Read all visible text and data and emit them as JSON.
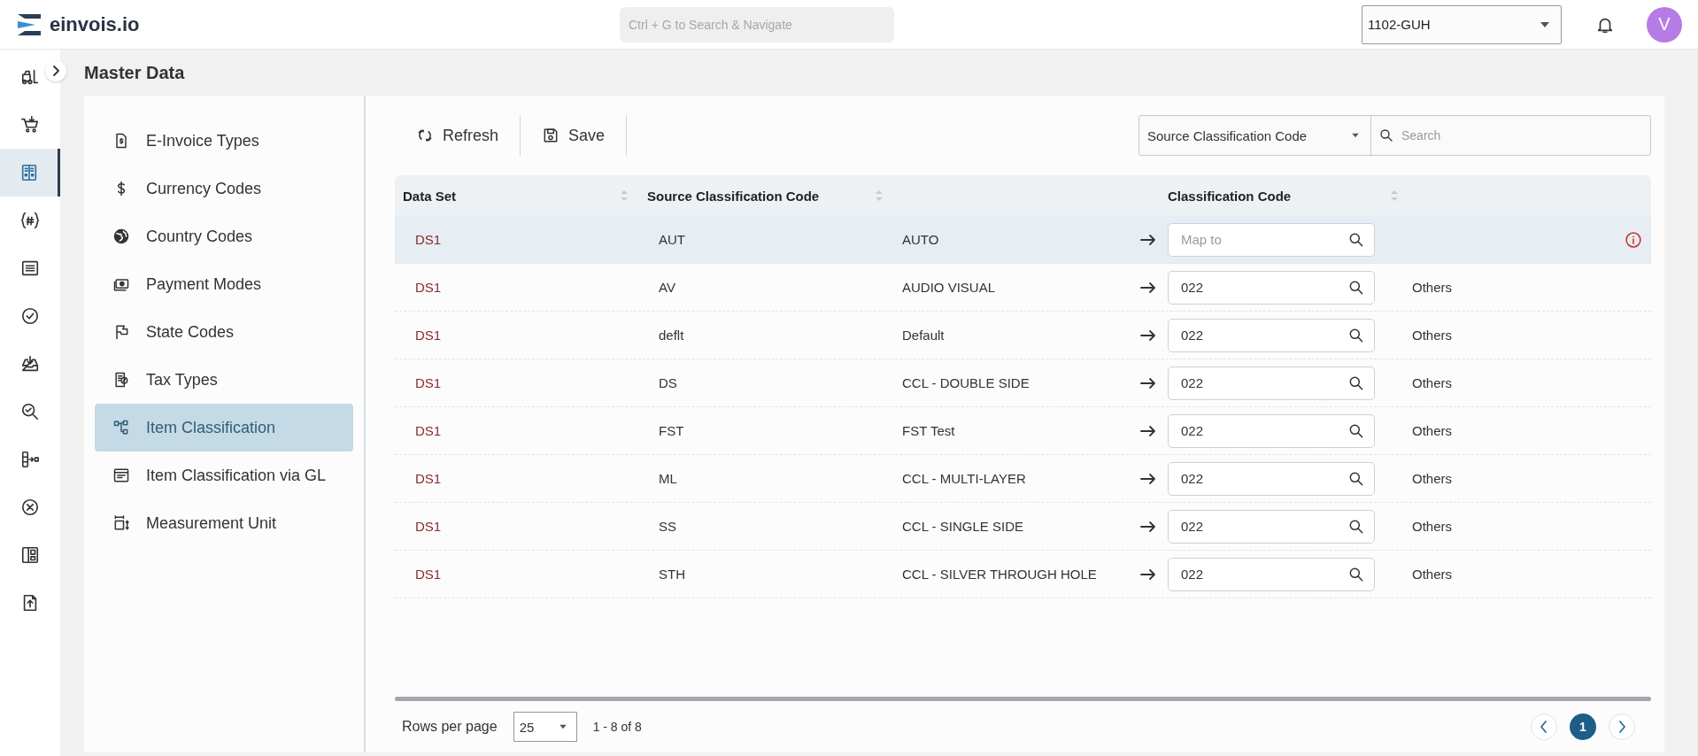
{
  "brand": {
    "name": "einvois.io"
  },
  "global_search": {
    "placeholder": "Ctrl + G to Search & Navigate"
  },
  "company_select": {
    "value": "1102-GUH"
  },
  "avatar": {
    "initial": "V"
  },
  "rail": [
    {
      "selected": false
    },
    {
      "selected": false
    },
    {
      "selected": true
    },
    {
      "selected": false
    },
    {
      "selected": false
    },
    {
      "selected": false
    },
    {
      "selected": false
    },
    {
      "selected": false
    },
    {
      "selected": false
    },
    {
      "selected": false
    },
    {
      "selected": false
    },
    {
      "selected": false
    }
  ],
  "page_title": "Master Data",
  "menu": [
    {
      "label": "E-Invoice Types",
      "selected": false
    },
    {
      "label": "Currency Codes",
      "selected": false
    },
    {
      "label": "Country Codes",
      "selected": false
    },
    {
      "label": "Payment Modes",
      "selected": false
    },
    {
      "label": "State Codes",
      "selected": false
    },
    {
      "label": "Tax Types",
      "selected": false
    },
    {
      "label": "Item Classification",
      "selected": true
    },
    {
      "label": "Item Classification via GL",
      "selected": false
    },
    {
      "label": "Measurement Unit",
      "selected": false
    }
  ],
  "toolbar": {
    "buttons": [
      {
        "label": "Refresh",
        "kind": "refresh"
      },
      {
        "label": "Save",
        "kind": "save"
      }
    ],
    "filter_select": {
      "value": "Source Classification Code"
    },
    "search": {
      "placeholder": "Search"
    }
  },
  "table": {
    "columns": [
      {
        "label": "Data Set"
      },
      {
        "label": "Source Classification Code"
      },
      {
        "label": "Classification Code"
      }
    ],
    "rows": [
      {
        "data_set": "DS1",
        "source_code": "AUT",
        "description": "AUTO",
        "code_placeholder": "Map to",
        "selected": true,
        "error": true
      },
      {
        "data_set": "DS1",
        "source_code": "AV",
        "description": "AUDIO VISUAL",
        "code": "022",
        "code_name": "Others",
        "selected": false,
        "error": false
      },
      {
        "data_set": "DS1",
        "source_code": "deflt",
        "description": "Default",
        "code": "022",
        "code_name": "Others",
        "selected": false,
        "error": false
      },
      {
        "data_set": "DS1",
        "source_code": "DS",
        "description": "CCL - DOUBLE SIDE",
        "code": "022",
        "code_name": "Others",
        "selected": false,
        "error": false
      },
      {
        "data_set": "DS1",
        "source_code": "FST",
        "description": "FST Test",
        "code": "022",
        "code_name": "Others",
        "selected": false,
        "error": false
      },
      {
        "data_set": "DS1",
        "source_code": "ML",
        "description": "CCL - MULTI-LAYER",
        "code": "022",
        "code_name": "Others",
        "selected": false,
        "error": false
      },
      {
        "data_set": "DS1",
        "source_code": "SS",
        "description": "CCL - SINGLE SIDE",
        "code": "022",
        "code_name": "Others",
        "selected": false,
        "error": false
      },
      {
        "data_set": "DS1",
        "source_code": "STH",
        "description": "CCL - SILVER THROUGH HOLE",
        "code": "022",
        "code_name": "Others",
        "selected": false,
        "error": false
      }
    ]
  },
  "pagination": {
    "rows_per_page_label": "Rows per page",
    "rows_per_page": "25",
    "range": "1 - 8 of 8",
    "pages": [
      {
        "label": "1",
        "selected": true
      }
    ]
  }
}
